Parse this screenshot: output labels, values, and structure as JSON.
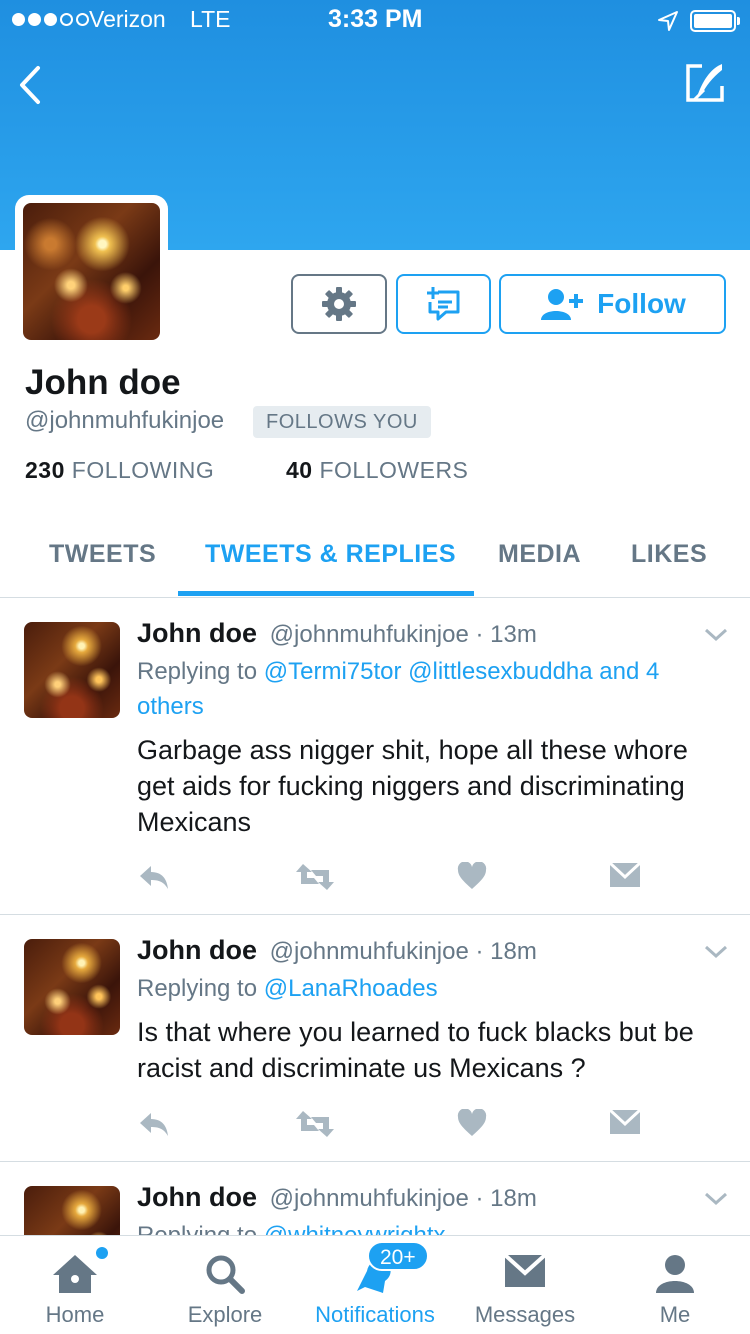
{
  "status_bar": {
    "carrier": "Verizon",
    "network": "LTE",
    "time": "3:33 PM"
  },
  "profile": {
    "name": "John doe",
    "handle": "@johnmuhfukinjoe",
    "follows_you": "FOLLOWS YOU",
    "following_count": "230",
    "following_label": "FOLLOWING",
    "followers_count": "40",
    "followers_label": "FOLLOWERS",
    "follow_label": "Follow"
  },
  "tabs": [
    {
      "label": "TWEETS"
    },
    {
      "label": "TWEETS & REPLIES",
      "active": true
    },
    {
      "label": "MEDIA"
    },
    {
      "label": "LIKES"
    }
  ],
  "tweets": [
    {
      "name": "John doe",
      "handle": "@johnmuhfukinjoe",
      "time": "· 13m",
      "replying_prefix": "Replying to",
      "replying_to": "@Termi75tor @littlesexbuddha and 4 others",
      "text": "Garbage ass nigger shit, hope all these whore get aids for fucking niggers and discriminating Mexicans"
    },
    {
      "name": "John doe",
      "handle": "@johnmuhfukinjoe",
      "time": "· 18m",
      "replying_prefix": "Replying to",
      "replying_to": "@LanaRhoades",
      "text": "Is that where you learned to fuck blacks but be racist and discriminate us Mexicans ?"
    },
    {
      "name": "John doe",
      "handle": "@johnmuhfukinjoe",
      "time": "· 18m",
      "replying_prefix": "Replying to",
      "replying_to": "@whitneywrightx",
      "text": ""
    }
  ],
  "tabbar": {
    "items": [
      {
        "label": "Home",
        "icon": "home-icon"
      },
      {
        "label": "Explore",
        "icon": "search-icon"
      },
      {
        "label": "Notifications",
        "icon": "bell-icon",
        "active": true
      },
      {
        "label": "Messages",
        "icon": "envelope-icon"
      },
      {
        "label": "Me",
        "icon": "person-icon"
      }
    ],
    "notifications_badge": "20+"
  },
  "colors": {
    "accent": "#1da1f2",
    "muted": "#657786",
    "header": "#2196e8"
  }
}
